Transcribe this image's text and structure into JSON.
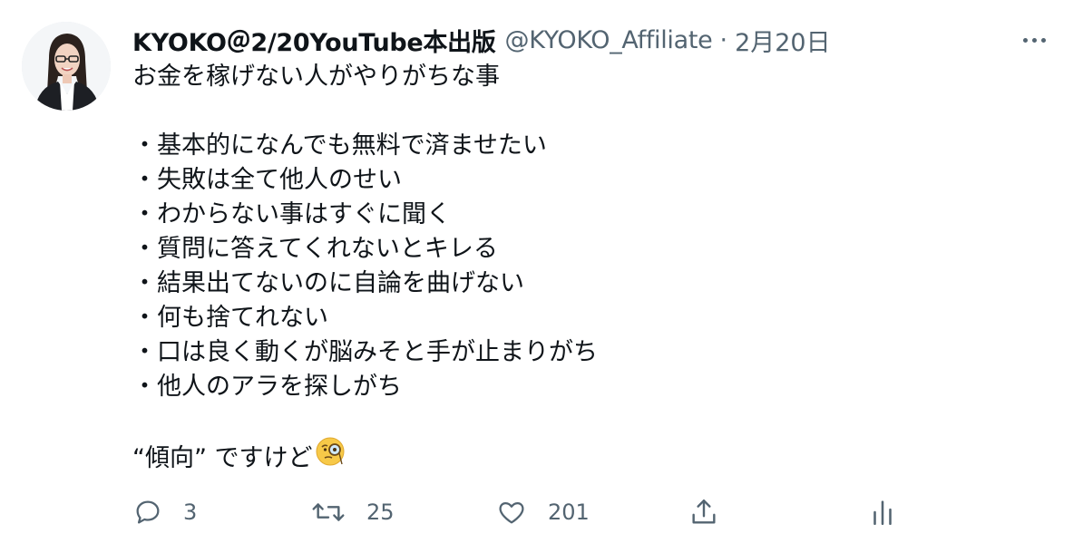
{
  "tweet": {
    "author": {
      "display_name": "KYOKO＠2/20YouTube本出版",
      "handle": "@KYOKO_Affiliate",
      "separator": "·",
      "timestamp": "2月20日"
    },
    "body": {
      "line_1": "お金を稼げない人がやりがちな事",
      "bullets": [
        "・基本的になんでも無料で済ませたい",
        "・失敗は全て他人のせい",
        "・わからない事はすぐに聞く",
        "・質問に答えてくれないとキレる",
        "・結果出てないのに自論を曲げない",
        "・何も捨てれない",
        "・口は良く動くが脳みそと手が止まりがち",
        "・他人のアラを探しがち"
      ],
      "closing": "“傾向” ですけど",
      "closing_emoji": "face-with-monocle-emoji"
    },
    "actions": {
      "reply_count": "3",
      "retweet_count": "25",
      "like_count": "201"
    }
  },
  "colors": {
    "text_primary": "#0f1419",
    "text_secondary": "#536471",
    "background": "#ffffff"
  }
}
